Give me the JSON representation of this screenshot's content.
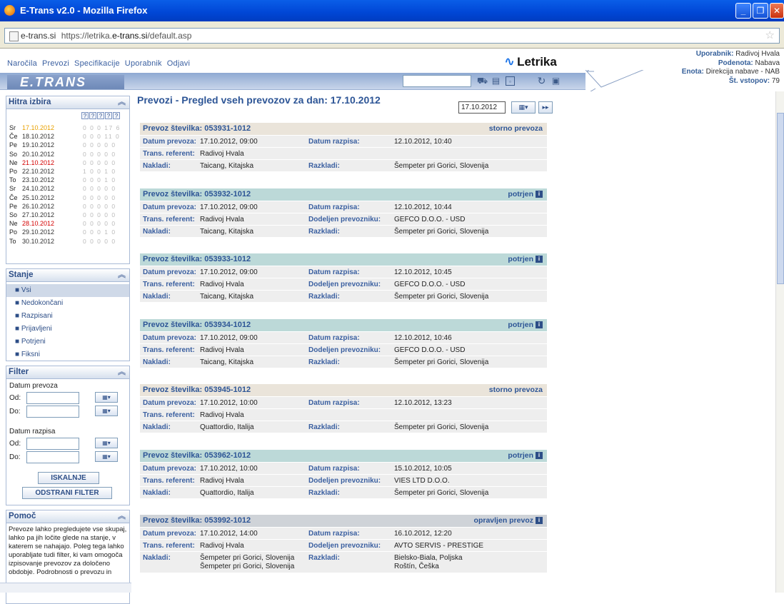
{
  "window": {
    "title": "E-Trans v2.0 - Mozilla Firefox"
  },
  "browser": {
    "site": "e-trans.si",
    "url_prefix": "https://letrika.",
    "url_domain": "e-trans.si",
    "url_path": "/default.asp"
  },
  "topnav": [
    "Naročila",
    "Prevozi",
    "Specifikacije",
    "Uporabnik",
    "Odjavi"
  ],
  "logo": "Letrika",
  "brand": "E.TRANS",
  "user": {
    "uporabnik_label": "Uporabnik:",
    "uporabnik": "Radivoj Hvala",
    "podenota_label": "Podenota:",
    "podenota": "Nabava",
    "enota_label": "Enota:",
    "enota": "Direkcija nabave - NAB",
    "vstopov_label": "Št. vstopov:",
    "vstopov": "79"
  },
  "quick": {
    "title": "Hitra izbira",
    "rows": [
      {
        "day": "Sr",
        "date": "17.10.2012",
        "counts": "0 0 0 17 6",
        "color": "#e8a000"
      },
      {
        "day": "Če",
        "date": "18.10.2012",
        "counts": "0 0 0 11 0",
        "color": "#333"
      },
      {
        "day": "Pe",
        "date": "19.10.2012",
        "counts": "0 0 0 0 0",
        "color": "#333"
      },
      {
        "day": "So",
        "date": "20.10.2012",
        "counts": "0 0 0 0 0",
        "color": "#333"
      },
      {
        "day": "Ne",
        "date": "21.10.2012",
        "counts": "0 0 0 0 0",
        "color": "#d40000"
      },
      {
        "day": "Po",
        "date": "22.10.2012",
        "counts": "1 0 0 1 0",
        "color": "#333"
      },
      {
        "day": "To",
        "date": "23.10.2012",
        "counts": "0 0 0 1 0",
        "color": "#333"
      },
      {
        "day": "Sr",
        "date": "24.10.2012",
        "counts": "0 0 0 0 0",
        "color": "#333"
      },
      {
        "day": "Če",
        "date": "25.10.2012",
        "counts": "0 0 0 0 0",
        "color": "#333"
      },
      {
        "day": "Pe",
        "date": "26.10.2012",
        "counts": "0 0 0 0 0",
        "color": "#333"
      },
      {
        "day": "So",
        "date": "27.10.2012",
        "counts": "0 0 0 0 0",
        "color": "#333"
      },
      {
        "day": "Ne",
        "date": "28.10.2012",
        "counts": "0 0 0 0 0",
        "color": "#d40000"
      },
      {
        "day": "Po",
        "date": "29.10.2012",
        "counts": "0 0 0 1 0",
        "color": "#333"
      },
      {
        "day": "To",
        "date": "30.10.2012",
        "counts": "0 0 0 0 0",
        "color": "#333"
      }
    ]
  },
  "stanje": {
    "title": "Stanje",
    "items": [
      "Vsi",
      "Nedokončani",
      "Razpisani",
      "Prijavljeni",
      "Potrjeni",
      "Fiksni"
    ]
  },
  "filter": {
    "title": "Filter",
    "datum_prevoza": "Datum prevoza",
    "datum_razpisa": "Datum razpisa",
    "od": "Od:",
    "do": "Do:",
    "search_button": "ISKALNJE",
    "remove_button": "ODSTRANI FILTER"
  },
  "help": {
    "title": "Pomoč",
    "text": "Prevoze lahko pregledujete vse skupaj, lahko pa jih ločite glede na stanje, v katerem se nahajajo. Poleg tega lahko uporabljate tudi filter, ki vam omogoča izpisovanje prevozov za določeno obdobje. Podrobnosti o prevozu in"
  },
  "main": {
    "title": "Prevozi - Pregled vseh prevozov za dan: 17.10.2012",
    "date_value": "17.10.2012"
  },
  "labels": {
    "prevoz_stevilka": "Prevoz številka:",
    "datum_prevoza": "Datum prevoza:",
    "datum_razpisa": "Datum razpisa:",
    "trans_referent": "Trans. referent:",
    "dodeljen": "Dodeljen prevozniku:",
    "nakladi": "Nakladi:",
    "razkladi": "Razkladi:"
  },
  "records": [
    {
      "number": "053931-1012",
      "status": "storno prevoza",
      "kind": "storno",
      "datum_prevoza": "17.10.2012, 09:00",
      "datum_razpisa": "12.10.2012, 10:40",
      "referent": "Radivoj Hvala",
      "prevoznik": "",
      "nakladi": "Taicang, Kitajska",
      "razkladi": "Šempeter pri Gorici, Slovenija"
    },
    {
      "number": "053932-1012",
      "status": "potrjen",
      "kind": "potrjen",
      "datum_prevoza": "17.10.2012, 09:00",
      "datum_razpisa": "12.10.2012, 10:44",
      "referent": "Radivoj Hvala",
      "prevoznik": "GEFCO D.O.O. - USD",
      "nakladi": "Taicang, Kitajska",
      "razkladi": "Šempeter pri Gorici, Slovenija"
    },
    {
      "number": "053933-1012",
      "status": "potrjen",
      "kind": "potrjen",
      "datum_prevoza": "17.10.2012, 09:00",
      "datum_razpisa": "12.10.2012, 10:45",
      "referent": "Radivoj Hvala",
      "prevoznik": "GEFCO D.O.O. - USD",
      "nakladi": "Taicang, Kitajska",
      "razkladi": "Šempeter pri Gorici, Slovenija"
    },
    {
      "number": "053934-1012",
      "status": "potrjen",
      "kind": "potrjen",
      "datum_prevoza": "17.10.2012, 09:00",
      "datum_razpisa": "12.10.2012, 10:46",
      "referent": "Radivoj Hvala",
      "prevoznik": "GEFCO D.O.O. - USD",
      "nakladi": "Taicang, Kitajska",
      "razkladi": "Šempeter pri Gorici, Slovenija"
    },
    {
      "number": "053945-1012",
      "status": "storno prevoza",
      "kind": "storno",
      "datum_prevoza": "17.10.2012, 10:00",
      "datum_razpisa": "12.10.2012, 13:23",
      "referent": "Radivoj Hvala",
      "prevoznik": "",
      "nakladi": "Quattordio, Italija",
      "razkladi": "Šempeter pri Gorici, Slovenija"
    },
    {
      "number": "053962-1012",
      "status": "potrjen",
      "kind": "potrjen",
      "datum_prevoza": "17.10.2012, 10:00",
      "datum_razpisa": "15.10.2012, 10:05",
      "referent": "Radivoj Hvala",
      "prevoznik": "VIES LTD D.O.O.",
      "nakladi": "Quattordio, Italija",
      "razkladi": "Šempeter pri Gorici, Slovenija"
    },
    {
      "number": "053992-1012",
      "status": "opravljen prevoz",
      "kind": "opravljen",
      "datum_prevoza": "17.10.2012, 14:00",
      "datum_razpisa": "16.10.2012, 12:20",
      "referent": "Radivoj Hvala",
      "prevoznik": "AVTO SERVIS - PRESTIGE",
      "nakladi": "Šempeter pri Gorici, Slovenija",
      "nakladi2": "Šempeter pri Gorici, Slovenija",
      "razkladi": "Bielsko-Biala, Poljska",
      "razkladi2": "Roštín, Češka"
    }
  ]
}
